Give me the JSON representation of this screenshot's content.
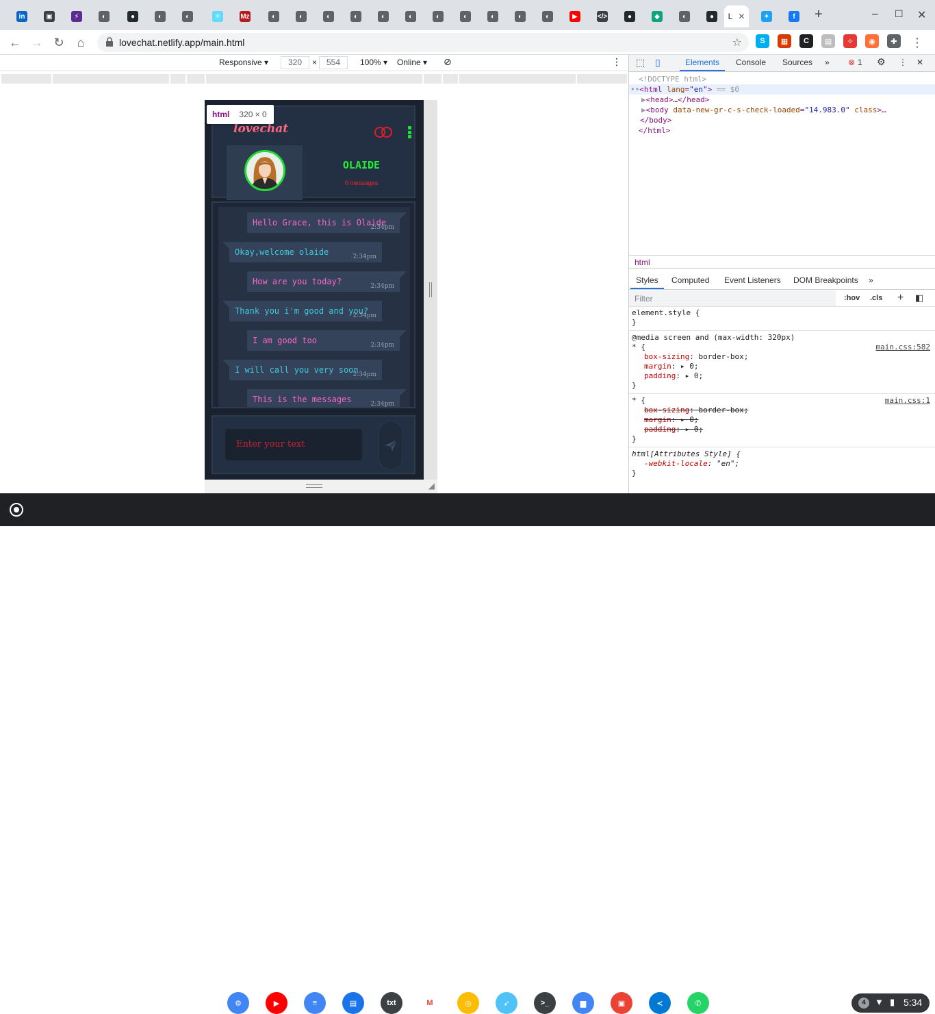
{
  "browser": {
    "active_tab_title": "L",
    "url": "lovechat.netlify.app/main.html",
    "tabs": [
      {
        "icon": "linkedin-icon",
        "color": "#0a66c2",
        "glyph": "in"
      },
      {
        "icon": "briefcase-icon",
        "color": "#3c4043",
        "glyph": "▣"
      },
      {
        "icon": "lightning-icon",
        "color": "#5c2d91",
        "glyph": "⚡"
      },
      {
        "icon": "generic-site-icon",
        "color": "#5f6368",
        "glyph": "◐"
      },
      {
        "icon": "github-icon",
        "color": "#24292e",
        "glyph": "●"
      },
      {
        "icon": "generic-site-icon",
        "color": "#5f6368",
        "glyph": "◐"
      },
      {
        "icon": "generic-site-icon",
        "color": "#5f6368",
        "glyph": "◐"
      },
      {
        "icon": "react-icon",
        "color": "#61dafb",
        "glyph": "⚛"
      },
      {
        "icon": "mz-icon",
        "color": "#b71c1c",
        "glyph": "Mz"
      },
      {
        "icon": "generic-site-icon",
        "color": "#5f6368",
        "glyph": "◐"
      },
      {
        "icon": "generic-site-icon",
        "color": "#5f6368",
        "glyph": "◐"
      },
      {
        "icon": "generic-site-icon",
        "color": "#5f6368",
        "glyph": "◐"
      },
      {
        "icon": "generic-site-icon",
        "color": "#5f6368",
        "glyph": "◐"
      },
      {
        "icon": "generic-site-icon",
        "color": "#5f6368",
        "glyph": "◐"
      },
      {
        "icon": "generic-site-icon",
        "color": "#5f6368",
        "glyph": "◐"
      },
      {
        "icon": "generic-site-icon",
        "color": "#5f6368",
        "glyph": "◐"
      },
      {
        "icon": "generic-site-icon",
        "color": "#5f6368",
        "glyph": "◐"
      },
      {
        "icon": "generic-site-icon",
        "color": "#5f6368",
        "glyph": "◐"
      },
      {
        "icon": "generic-site-icon",
        "color": "#5f6368",
        "glyph": "◐"
      },
      {
        "icon": "generic-site-icon",
        "color": "#5f6368",
        "glyph": "◐"
      },
      {
        "icon": "youtube-icon",
        "color": "#ff0000",
        "glyph": "▶"
      },
      {
        "icon": "code-icon",
        "color": "#3c4043",
        "glyph": "</>"
      },
      {
        "icon": "github-icon",
        "color": "#24292e",
        "glyph": "●"
      },
      {
        "icon": "diamond-icon",
        "color": "#10a37f",
        "glyph": "◆"
      },
      {
        "icon": "generic-site-icon",
        "color": "#5f6368",
        "glyph": "◐"
      },
      {
        "icon": "github-icon",
        "color": "#24292e",
        "glyph": "●"
      },
      {
        "icon": "twitter-icon",
        "color": "#1da1f2",
        "glyph": "✦"
      },
      {
        "icon": "facebook-icon",
        "color": "#1877f2",
        "glyph": "f"
      }
    ],
    "extensions": [
      {
        "icon": "skype-icon",
        "color": "#00aff0",
        "glyph": "S"
      },
      {
        "icon": "office-icon",
        "color": "#d83b01",
        "glyph": "▦"
      },
      {
        "icon": "crop-icon",
        "color": "#202124",
        "glyph": "C"
      },
      {
        "icon": "grid-extension-icon",
        "color": "#bdbdbd",
        "glyph": "▤"
      },
      {
        "icon": "magic-icon",
        "color": "#e53935",
        "glyph": "✧"
      },
      {
        "icon": "fox-icon",
        "color": "#ff7139",
        "glyph": "◉"
      },
      {
        "icon": "puzzle-icon",
        "color": "#5f6368",
        "glyph": "✚"
      }
    ]
  },
  "devicebar": {
    "device": "Responsive ▾",
    "width": "320",
    "times": "×",
    "height": "554",
    "zoom": "100% ▾",
    "network": "Online ▾"
  },
  "tooltip": {
    "tag": "html",
    "dims": "320 × 0"
  },
  "app": {
    "logo": "lovechat",
    "user_name": "OLAIDE",
    "message_count": "0 messages",
    "messages": [
      {
        "dir": "out",
        "text": "Hello Grace, this is Olaide",
        "time": "2:34pm"
      },
      {
        "dir": "in",
        "text": "Okay,welcome olaide",
        "time": "2:34pm"
      },
      {
        "dir": "out",
        "text": "How are you today?",
        "time": "2:34pm"
      },
      {
        "dir": "in",
        "text": "Thank you i'm good and you?",
        "time": "2:34pm"
      },
      {
        "dir": "out",
        "text": "I am good too",
        "time": "2:34pm"
      },
      {
        "dir": "in",
        "text": "I will call you very soon",
        "time": "2:34pm"
      },
      {
        "dir": "out",
        "text": "This is the messages",
        "time": "2:34pm"
      }
    ],
    "input_placeholder": "Enter your text",
    "colors": {
      "accent_pink": "#ff66cc",
      "accent_cyan": "#3fc8dd",
      "online_green": "#22dd33"
    }
  },
  "devtools": {
    "tabs": [
      "Elements",
      "Console",
      "Sources"
    ],
    "more": "»",
    "error_count": "1",
    "dom": {
      "doctype": "<!DOCTYPE html>",
      "html_open_tag": "html",
      "html_attr": "lang",
      "html_attr_val": "\"en\"",
      "html_selected": "== $0",
      "head": "…",
      "body_attr": "data-new-gr-c-s-check-loaded",
      "body_attr_val": "\"14.983.0\"",
      "body_attr2": "class",
      "body_ellipsis": ">…",
      "body_close": "</body>",
      "html_close": "</html>"
    },
    "breadcrumb": "html",
    "style_tabs": [
      "Styles",
      "Computed",
      "Event Listeners",
      "DOM Breakpoints"
    ],
    "style_more": "»",
    "filter_placeholder": "Filter",
    "hov": ":hov",
    "cls": ".cls",
    "rules": {
      "element_style": "element.style {",
      "media": "@media screen and (max-width: 320px)",
      "star_open": "* {",
      "src1": "main.css:582",
      "src2": "main.css:1",
      "box_sizing": "box-sizing",
      "box_val": "border-box;",
      "margin": "margin",
      "padding": "padding",
      "zero": "0;",
      "attr_style": "html[Attributes Style] {",
      "locale_prop": "-webkit-locale",
      "locale_val": "\"en\";",
      "close": "}"
    }
  },
  "shelf": {
    "apps": [
      {
        "icon": "settings-icon",
        "color": "#4285f4",
        "glyph": "⚙"
      },
      {
        "icon": "youtube-icon",
        "color": "#ff0000",
        "glyph": "▶"
      },
      {
        "icon": "docs-icon",
        "color": "#4285f4",
        "glyph": "≡"
      },
      {
        "icon": "messages-icon",
        "color": "#1a73e8",
        "glyph": "▤"
      },
      {
        "icon": "text-icon",
        "color": "#3c4043",
        "glyph": "txt"
      },
      {
        "icon": "gmail-icon",
        "color": "#ffffff",
        "glyph": "M"
      },
      {
        "icon": "chrome-icon",
        "color": "#fbbc04",
        "glyph": "◎"
      },
      {
        "icon": "rocket-icon",
        "color": "#4fc3f7",
        "glyph": "➶"
      },
      {
        "icon": "terminal-icon",
        "color": "#3c4043",
        "glyph": ">_"
      },
      {
        "icon": "files-icon",
        "color": "#4285f4",
        "glyph": "▆"
      },
      {
        "icon": "screencast-icon",
        "color": "#ea4335",
        "glyph": "▣"
      },
      {
        "icon": "vscode-icon",
        "color": "#0078d4",
        "glyph": "≺"
      },
      {
        "icon": "whatsapp-icon",
        "color": "#25d366",
        "glyph": "✆"
      }
    ],
    "notification_count": "4",
    "time": "5:34"
  }
}
